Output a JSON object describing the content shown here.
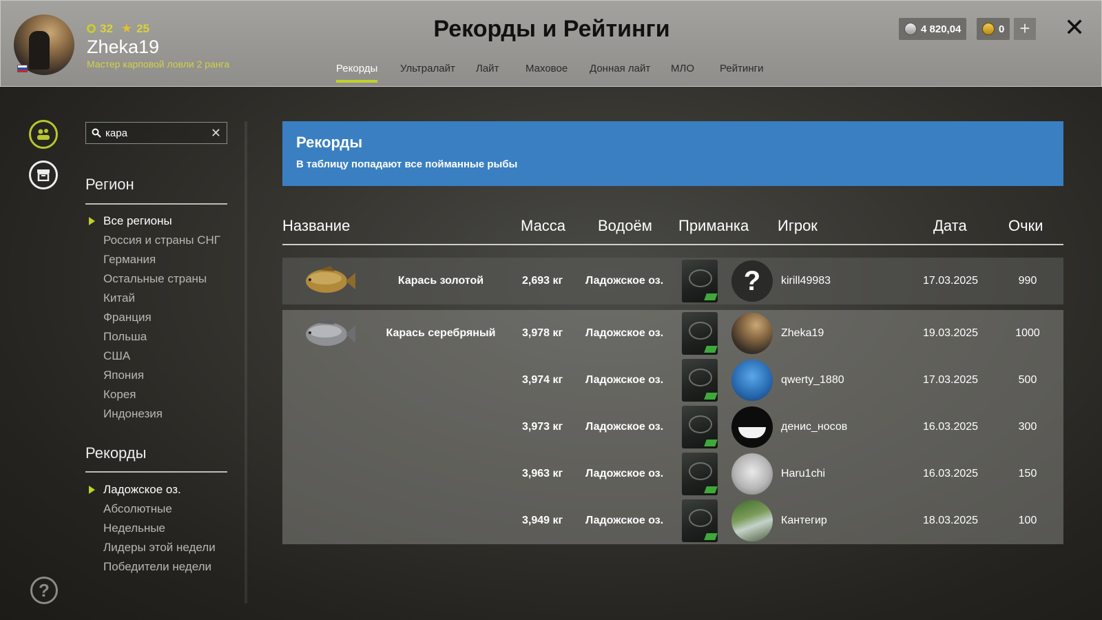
{
  "header": {
    "title": "Рекорды и Рейтинги",
    "user": {
      "level": "32",
      "stars": "25",
      "name": "Zheka19",
      "rank": "Мастер карповой ловли 2 ранга"
    },
    "tabs": [
      {
        "label": "Рекорды",
        "active": true
      },
      {
        "label": "Ультралайт",
        "active": false
      },
      {
        "label": "Лайт",
        "active": false
      },
      {
        "label": "Маховое",
        "active": false
      },
      {
        "label": "Донная лайт",
        "active": false
      },
      {
        "label": "МЛО",
        "active": false
      },
      {
        "label": "Рейтинги",
        "active": false
      }
    ],
    "silver": "4 820,04",
    "gold": "0",
    "plus": "+",
    "close": "✕"
  },
  "sidebar": {
    "search_value": "кара",
    "region_title": "Регион",
    "regions": [
      {
        "label": "Все регионы",
        "active": true
      },
      {
        "label": "Россия и страны СНГ",
        "active": false
      },
      {
        "label": "Германия",
        "active": false
      },
      {
        "label": "Остальные страны",
        "active": false
      },
      {
        "label": "Китай",
        "active": false
      },
      {
        "label": "Франция",
        "active": false
      },
      {
        "label": "Польша",
        "active": false
      },
      {
        "label": "США",
        "active": false
      },
      {
        "label": "Япония",
        "active": false
      },
      {
        "label": "Корея",
        "active": false
      },
      {
        "label": "Индонезия",
        "active": false
      }
    ],
    "records_title": "Рекорды",
    "records": [
      {
        "label": "Ладожское оз.",
        "active": true
      },
      {
        "label": "Абсолютные",
        "active": false
      },
      {
        "label": "Недельные",
        "active": false
      },
      {
        "label": "Лидеры этой недели",
        "active": false
      },
      {
        "label": "Победители недели",
        "active": false
      }
    ]
  },
  "banner": {
    "title": "Рекорды",
    "subtitle": "В таблицу попадают все пойманные рыбы"
  },
  "table": {
    "columns": [
      "Название",
      "Масса",
      "Водоём",
      "Приманка",
      "Игрок",
      "Дата",
      "Очки"
    ],
    "rows": [
      {
        "fish": "Карась золотой",
        "mass": "2,693 кг",
        "water": "Ладожское оз.",
        "player": "kirill49983",
        "date": "17.03.2025",
        "points": "990",
        "avatar": "unknown"
      },
      {
        "fish": "Карась серебряный",
        "mass": "3,978 кг",
        "water": "Ладожское оз.",
        "player": "Zheka19",
        "date": "19.03.2025",
        "points": "1000",
        "avatar": "zheka"
      },
      {
        "fish": "",
        "mass": "3,974 кг",
        "water": "Ладожское оз.",
        "player": "qwerty_1880",
        "date": "17.03.2025",
        "points": "500",
        "avatar": "qwerty"
      },
      {
        "fish": "",
        "mass": "3,973 кг",
        "water": "Ладожское оз.",
        "player": "денис_носов",
        "date": "16.03.2025",
        "points": "300",
        "avatar": "denis"
      },
      {
        "fish": "",
        "mass": "3,963 кг",
        "water": "Ладожское оз.",
        "player": "Haru1chi",
        "date": "16.03.2025",
        "points": "150",
        "avatar": "haru"
      },
      {
        "fish": "",
        "mass": "3,949 кг",
        "water": "Ладожское оз.",
        "player": "Кантегир",
        "date": "18.03.2025",
        "points": "100",
        "avatar": "kant"
      }
    ]
  },
  "help": "?"
}
